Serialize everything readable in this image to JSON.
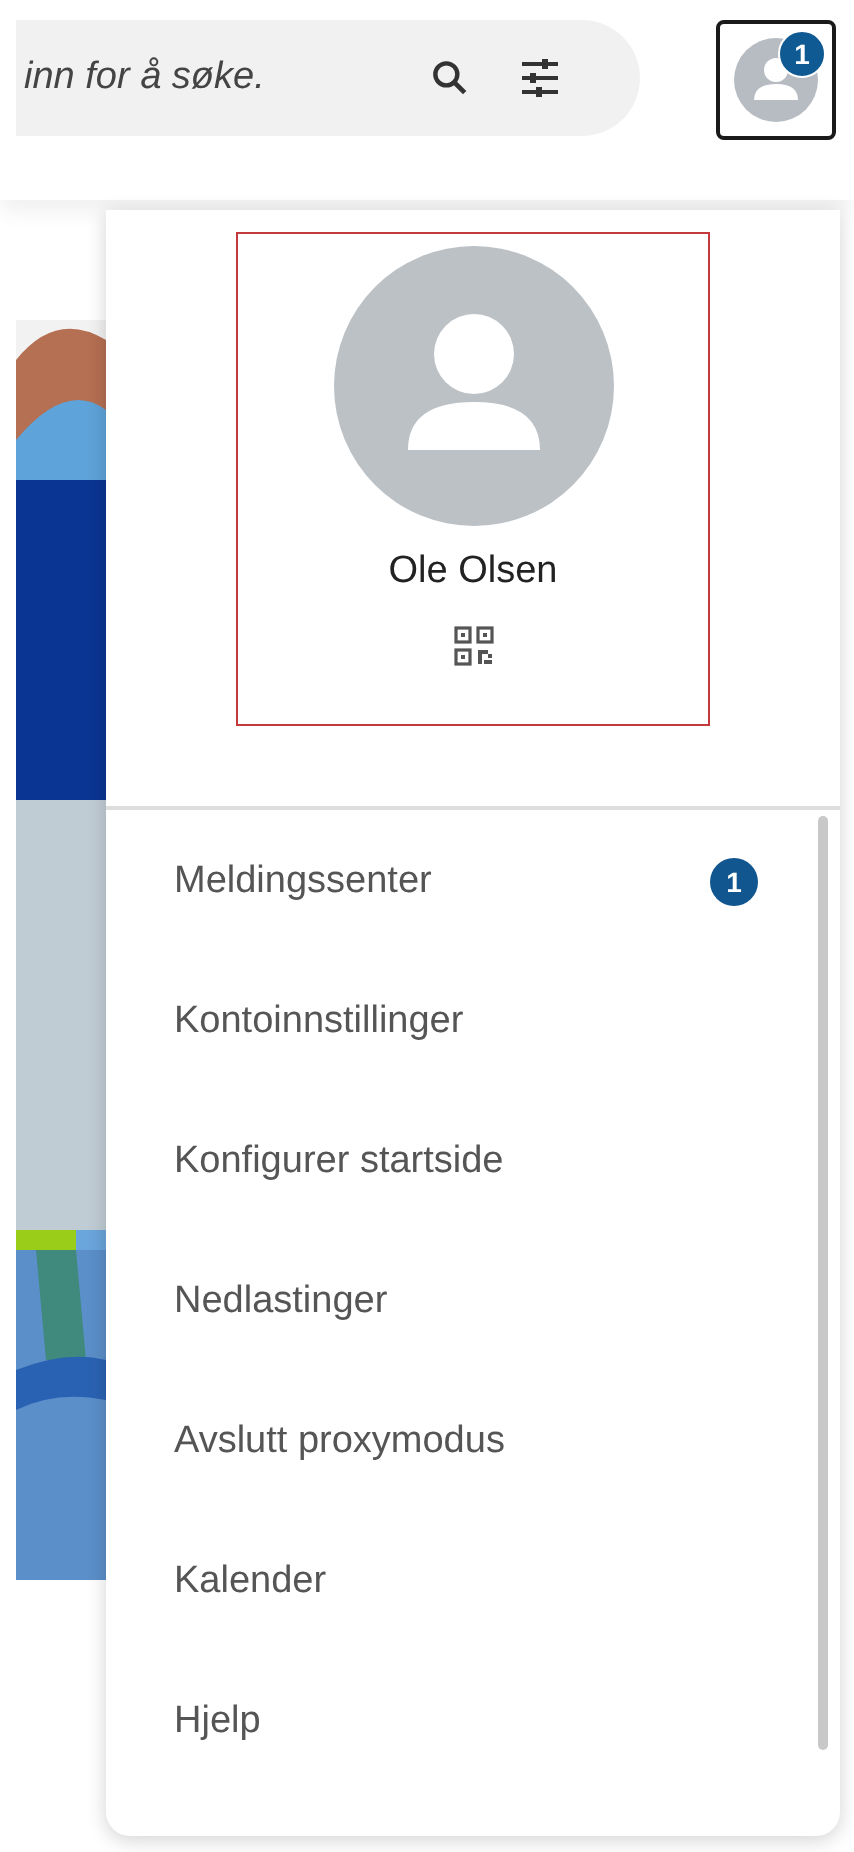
{
  "search": {
    "placeholder": "inn for å søke."
  },
  "account_button": {
    "badge": "1"
  },
  "profile": {
    "name": "Ole Olsen"
  },
  "menu": {
    "items": [
      {
        "label": "Meldingssenter",
        "badge": "1"
      },
      {
        "label": "Kontoinnstillinger"
      },
      {
        "label": "Konfigurer startside"
      },
      {
        "label": "Nedlastinger"
      },
      {
        "label": "Avslutt proxymodus"
      },
      {
        "label": "Kalender"
      },
      {
        "label": "Hjelp"
      }
    ]
  }
}
